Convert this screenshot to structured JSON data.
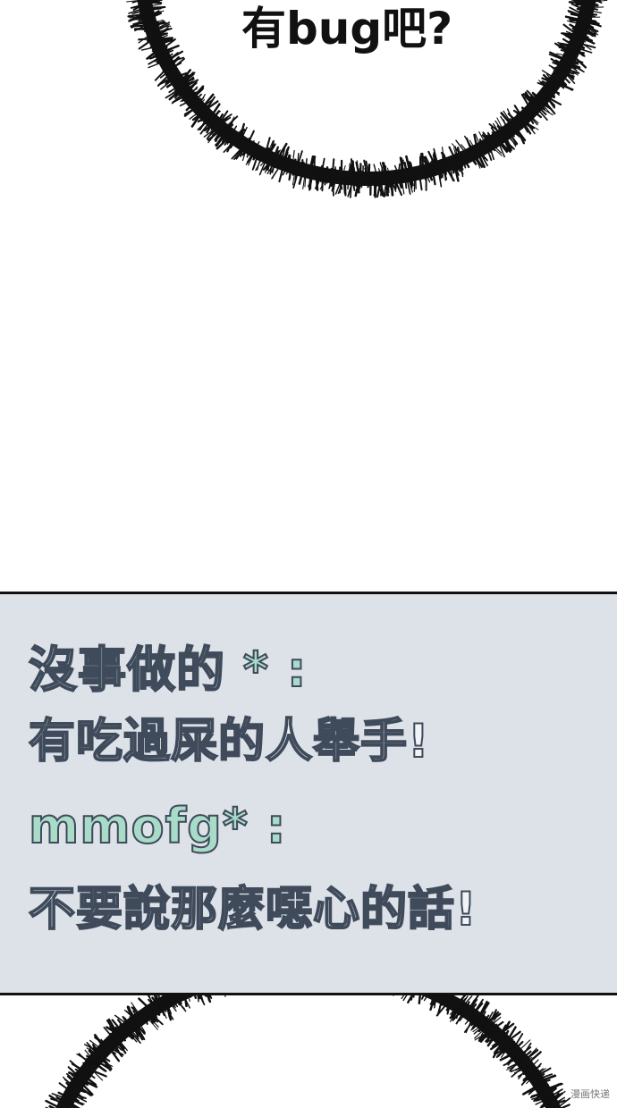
{
  "top_bubble": {
    "text": "有bug吧?"
  },
  "comment_panel": {
    "comments": [
      {
        "user": "沒事做的 * :",
        "message": "有吃過屎的人舉手!"
      },
      {
        "user": "mmofg* :",
        "message": "不要說那麼噁心的話!"
      }
    ]
  },
  "watermark": "漫画快递"
}
